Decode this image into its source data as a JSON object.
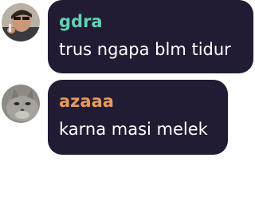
{
  "messages": [
    {
      "username": "gdra",
      "username_color": "#5fd3b4",
      "text": "trus ngapa blm tidur",
      "avatar": "person-avatar"
    },
    {
      "username": "azaaa",
      "username_color": "#e99a5a",
      "text": "karna masi melek",
      "avatar": "cat-avatar"
    }
  ]
}
